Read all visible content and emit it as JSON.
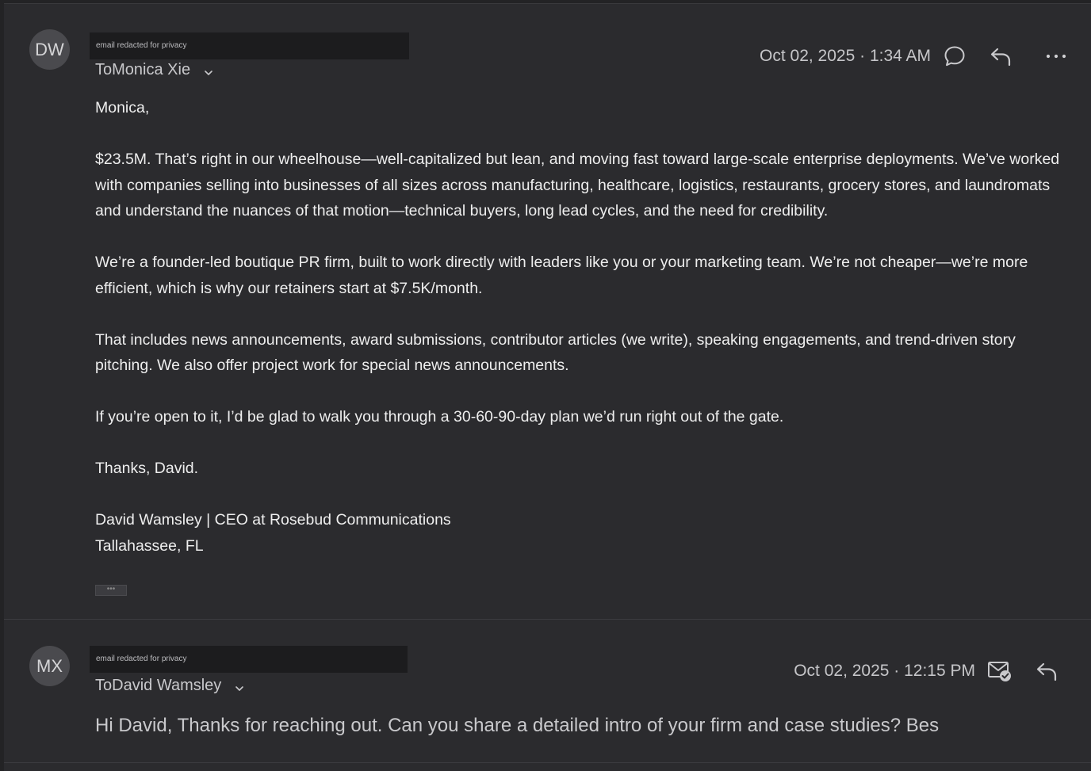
{
  "messages": [
    {
      "avatar_initials": "DW",
      "redacted_label": "email redacted for privacy",
      "to_prefix": "To",
      "to_name": "Monica Xie",
      "timestamp": "Oct 02, 2025 · 1:34 AM",
      "body": {
        "greeting": "Monica,",
        "p1": "$23.5M. That’s right in our wheelhouse—well-capitalized but lean, and moving fast toward large-scale enterprise deployments. We’ve worked with companies selling into businesses of all sizes across manufacturing, healthcare, logistics, restaurants, grocery stores, and laundromats and understand the nuances of that motion—technical buyers, long lead cycles, and the need for credibility.",
        "p2": "We’re a founder-led boutique PR firm, built to work directly with leaders like you or your marketing team. We’re not cheaper—we’re more efficient, which is why our retainers start at $7.5K/month.",
        "p3": "That includes news announcements, award submissions, contributor articles (we write), speaking engagements, and trend-driven story pitching. We also offer project work for special news announcements.",
        "p4": "If you’re open to it, I’d be glad to walk you through a 30-60-90-day plan we’d run right out of the gate.",
        "signoff": "Thanks, David.",
        "sig_line1": "David Wamsley | CEO at Rosebud Communications",
        "sig_line2": "Tallahassee, FL",
        "quoted_toggle": "•••"
      },
      "icons": [
        "comment-icon",
        "reply-icon",
        "more-options-icon"
      ]
    },
    {
      "avatar_initials": "MX",
      "redacted_label": "email redacted for privacy",
      "to_prefix": "To",
      "to_name": "David Wamsley",
      "timestamp": "Oct 02, 2025 · 12:15 PM",
      "snippet": "Hi David, Thanks for reaching out. Can you share a detailed intro of your firm and case studies?  Bes",
      "icons": [
        "mail-read-icon",
        "reply-icon"
      ]
    }
  ],
  "colors": {
    "background": "#2b2b2e",
    "text": "#eeeeee",
    "muted": "#c6c6c9",
    "avatar_bg": "#4a4a4e"
  }
}
